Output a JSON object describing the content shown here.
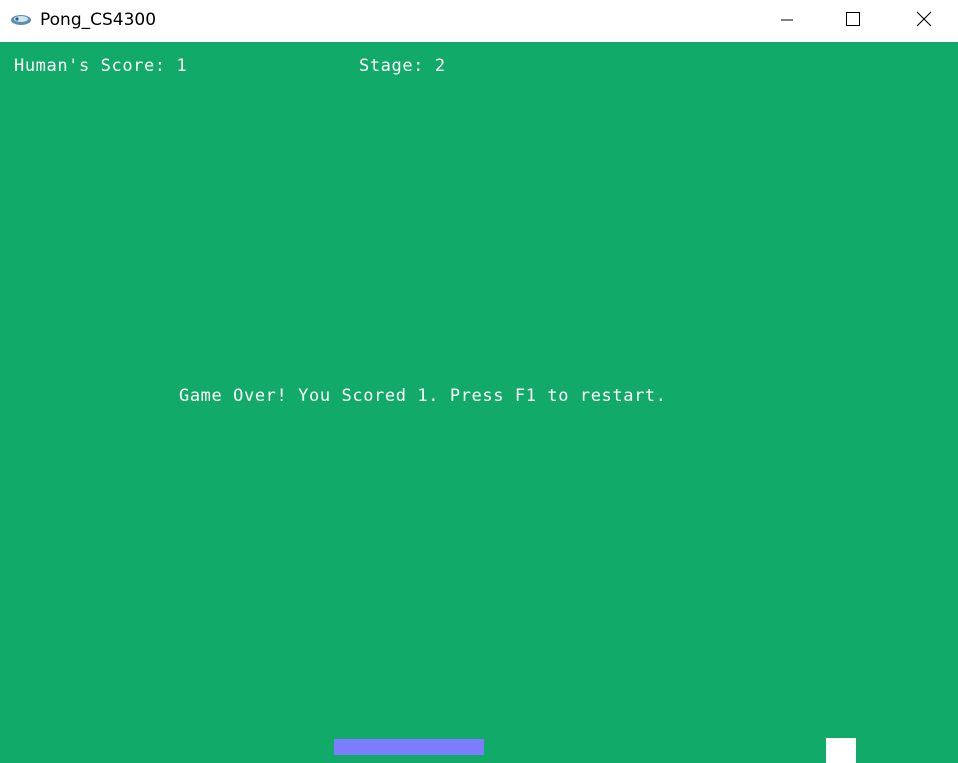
{
  "window": {
    "title": "Pong_CS4300",
    "icon": "app-logo-icon",
    "controls": [
      "minimize-icon",
      "maximize-icon",
      "close-icon"
    ]
  },
  "hud": {
    "score_text": "Human's Score: 1",
    "stage_text": "Stage: 2"
  },
  "message": {
    "game_over": "Game Over! You Scored 1. Press F1 to restart."
  },
  "colors": {
    "background": "#12aa69",
    "text": "#ffffff",
    "paddle": "#7c7cff",
    "ball": "#ffffff"
  }
}
